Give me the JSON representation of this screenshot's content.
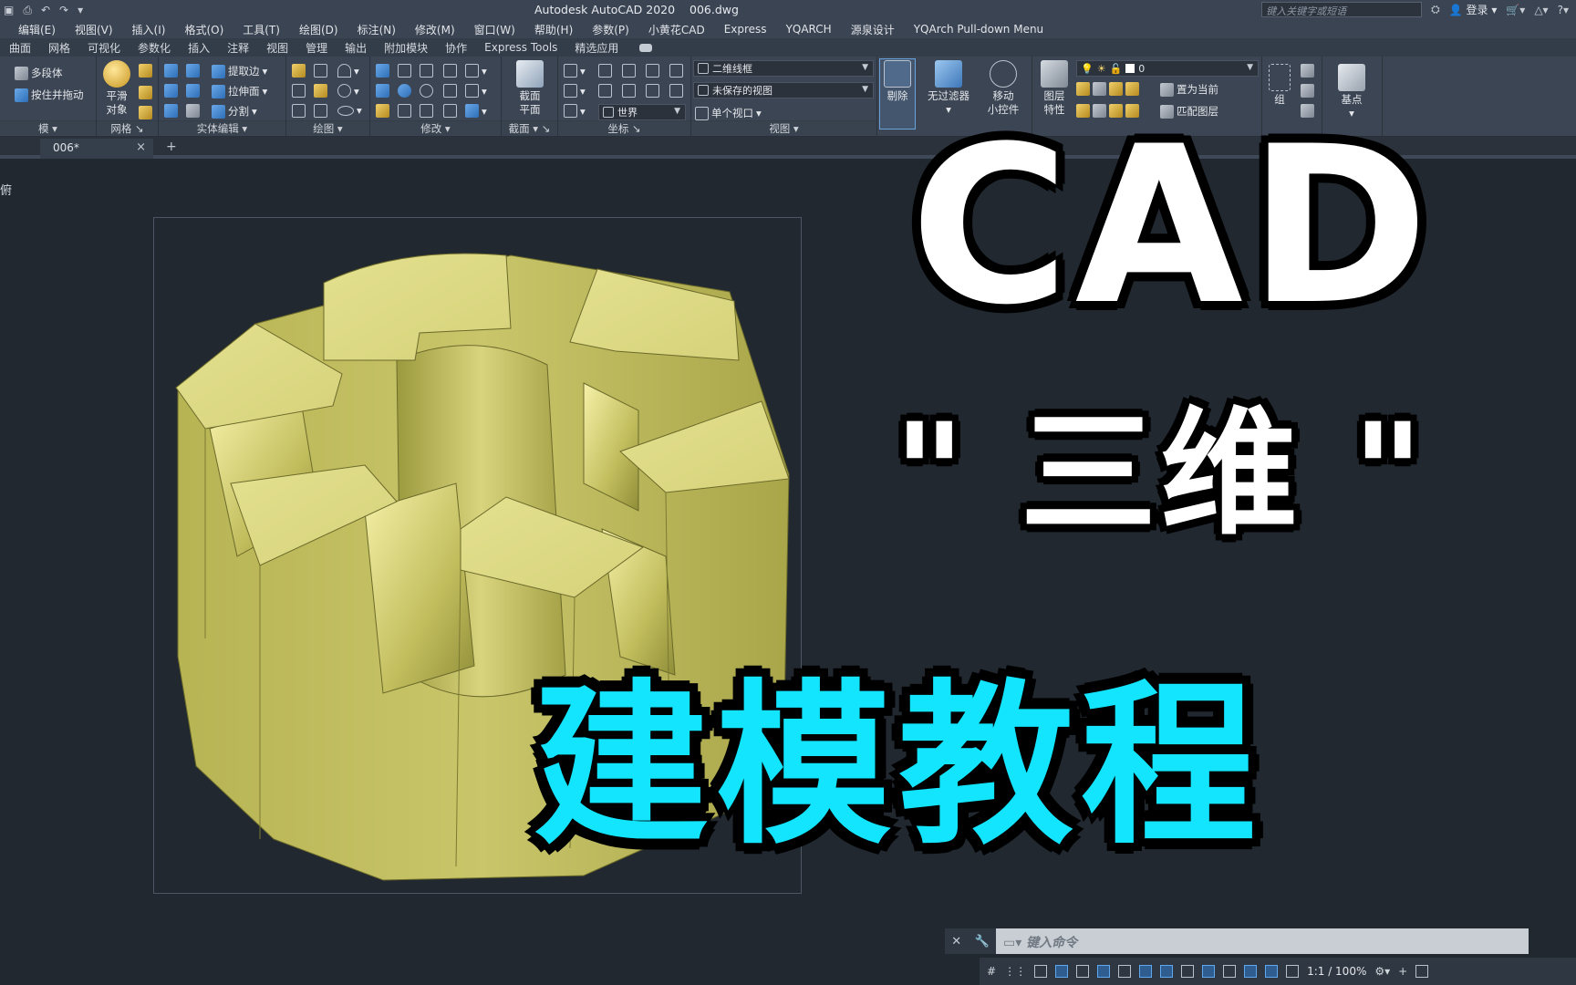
{
  "titlebar": {
    "app_title": "Autodesk AutoCAD 2020",
    "file_name": "006.dwg",
    "search_placeholder": "键入关键字或短语",
    "login_label": "登录"
  },
  "menu": [
    "编辑(E)",
    "视图(V)",
    "插入(I)",
    "格式(O)",
    "工具(T)",
    "绘图(D)",
    "标注(N)",
    "修改(M)",
    "窗口(W)",
    "帮助(H)",
    "参数(P)",
    "小黄花CAD",
    "Express",
    "YQARCH",
    "源泉设计",
    "YQArch Pull-down Menu"
  ],
  "ribbon_tabs": [
    "曲面",
    "网格",
    "可视化",
    "参数化",
    "插入",
    "注释",
    "视图",
    "管理",
    "输出",
    "附加模块",
    "协作",
    "Express Tools",
    "精选应用"
  ],
  "ribbon": {
    "modeling": {
      "polysolid": "多段体",
      "presspull": "按住并拖动",
      "label": "模"
    },
    "mesh": {
      "smooth": "平滑",
      "smooth2": "对象",
      "label": "网格"
    },
    "solid_edit": {
      "extract_edges": "提取边",
      "extrude_faces": "拉伸面",
      "separate": "分割",
      "label": "实体编辑"
    },
    "draw": {
      "label": "绘图"
    },
    "modify": {
      "label": "修改"
    },
    "section": {
      "plane": "截面",
      "plane2": "平面",
      "label": "截面"
    },
    "coordinates": {
      "world": "世界",
      "label": "坐标"
    },
    "view": {
      "visual_style": "二维线框",
      "saved_view": "未保存的视图",
      "viewport": "单个视口",
      "label": "视图"
    },
    "selection": {
      "cull": "剔除",
      "no_filter": "无过滤器",
      "gizmo": "移动",
      "gizmo2": "小控件"
    },
    "layers": {
      "properties": "图层",
      "properties2": "特性",
      "current_layer": "0",
      "set_current": "置为当前",
      "match_layer": "匹配图层"
    },
    "groups": {
      "group": "组"
    },
    "block": {
      "base_point": "基点"
    }
  },
  "doc_tab": {
    "name": "006*",
    "close": "×",
    "new": "+"
  },
  "viewport_label": "俯",
  "overlay": {
    "cad": "CAD",
    "sanwei": "\" 三维 \"",
    "tutorial": "建模教程"
  },
  "command_line": {
    "placeholder": "键入命令"
  },
  "status": {
    "zoom": "1:1 / 100%"
  },
  "colors": {
    "solid_fill": "#c9c56a",
    "overlay_cyan": "#13e5ff",
    "background": "#212830"
  }
}
